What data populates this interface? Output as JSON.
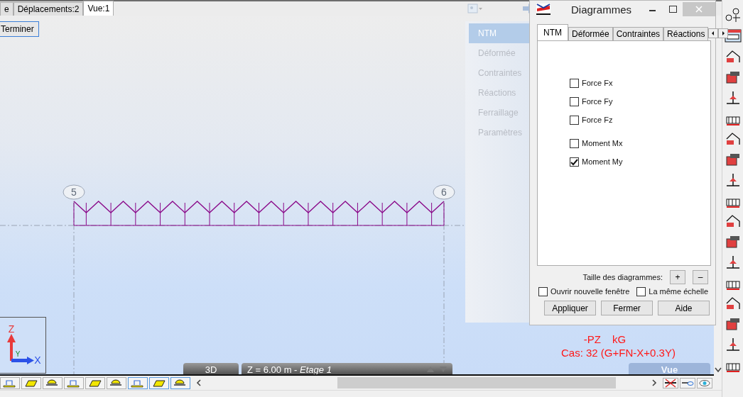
{
  "tabs": [
    {
      "label": "e",
      "selected": false
    },
    {
      "label": "Déplacements:2",
      "selected": false
    },
    {
      "label": "Vue:1",
      "selected": true
    }
  ],
  "finish_button": "Terminer",
  "side_menu": [
    {
      "label": "NTM",
      "selected": true
    },
    {
      "label": "Déformée",
      "selected": false
    },
    {
      "label": "Contraintes",
      "selected": false
    },
    {
      "label": "Réactions",
      "selected": false
    },
    {
      "label": "Ferraillage",
      "selected": false
    },
    {
      "label": "Paramètres",
      "selected": false
    }
  ],
  "nodes": [
    {
      "label": "5"
    },
    {
      "label": "6"
    }
  ],
  "axes": {
    "z": "Z",
    "y": "Y",
    "x": "X"
  },
  "result": {
    "quantity": "-PZ",
    "unit": "kG",
    "case": "Cas: 32 (G+FN-X+0.3Y)"
  },
  "view_bar": {
    "mode": "3D",
    "level": "Z = 6.00 m - *Etage 1*"
  },
  "view_button": "Vue",
  "dialog": {
    "title": "Diagrammes",
    "tabs": [
      {
        "label": "NTM",
        "selected": true
      },
      {
        "label": "Déformée",
        "selected": false
      },
      {
        "label": "Contraintes",
        "selected": false
      },
      {
        "label": "Réactions",
        "selected": false
      }
    ],
    "checkboxes": [
      {
        "label": "Force Fx",
        "checked": false
      },
      {
        "label": "Force Fy",
        "checked": false
      },
      {
        "label": "Force Fz",
        "checked": false
      },
      {
        "label": "Moment Mx",
        "checked": false
      },
      {
        "label": "Moment My",
        "checked": true
      }
    ],
    "size_label": "Taille des diagrammes:",
    "size_buttons": [
      "+",
      "–"
    ],
    "options": [
      {
        "label": "Ouvrir nouvelle fenêtre",
        "checked": false
      },
      {
        "label": "La même échelle",
        "checked": false
      }
    ],
    "buttons": [
      "Appliquer",
      "Fermer",
      "Aide"
    ]
  }
}
